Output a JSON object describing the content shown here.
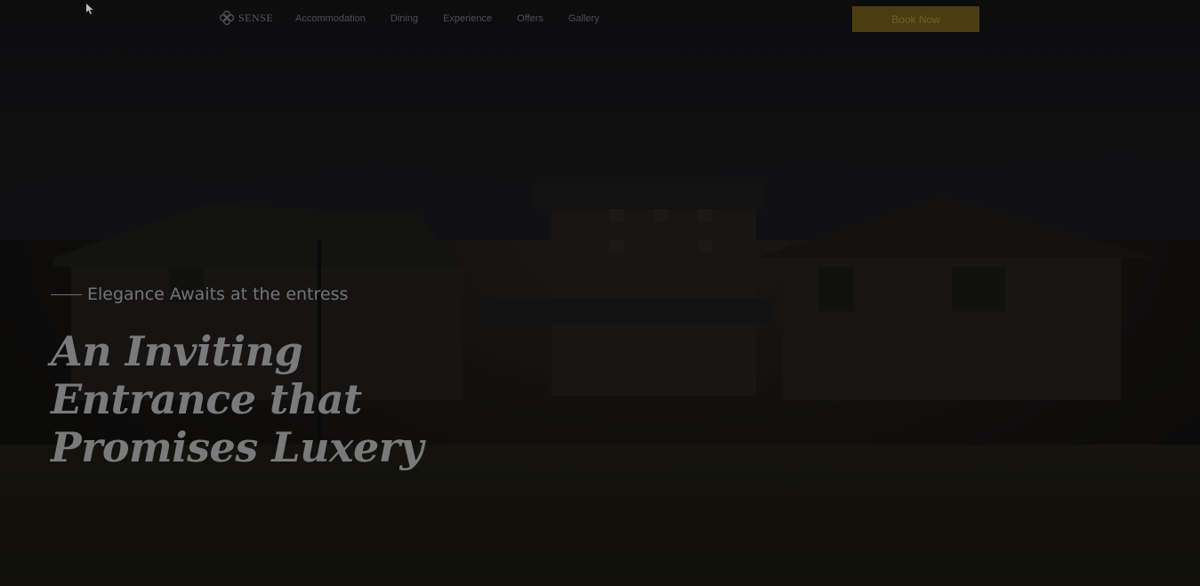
{
  "nav": {
    "logo_text": "SENSE",
    "links": [
      {
        "label": "Accommodation"
      },
      {
        "label": "Dining"
      },
      {
        "label": "Experience"
      },
      {
        "label": "Offers"
      },
      {
        "label": "Gallery"
      }
    ],
    "book_label": "Book Now"
  },
  "hero": {
    "eyebrow": "Elegance Awaits at the entress",
    "headline": "An Inviting Entrance that Promises Luxery"
  },
  "colors": {
    "accent": "#4a3e10",
    "background": "#111111"
  }
}
